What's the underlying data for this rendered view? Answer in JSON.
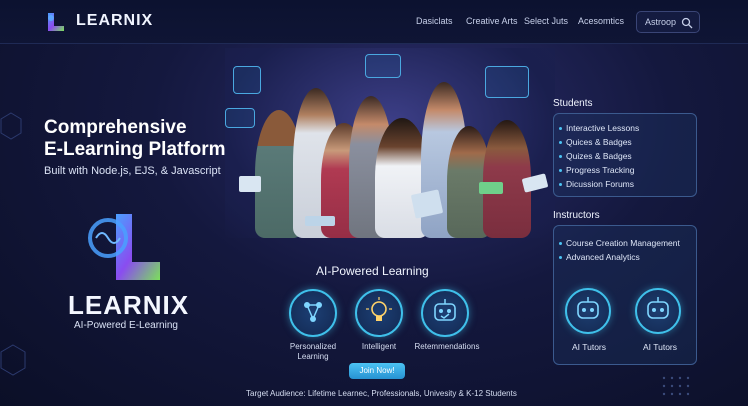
{
  "brand": {
    "name": "LEARNIX",
    "tagline": "AI-Powered E-Learning"
  },
  "nav": {
    "items": [
      "Dasiclats",
      "Creative Arts",
      "Select Juts",
      "Acesomtics"
    ],
    "search_label": "Astroop"
  },
  "hero": {
    "headline_line1": "Comprehensive",
    "headline_line2": "E-Learning Platform",
    "subline": "Built with Node.js, EJS, & Javascript"
  },
  "ai_section": {
    "title": "AI-Powered Learning",
    "features": [
      {
        "label_line1": "Personalized",
        "label_line2": "Learning",
        "icon": "network-icon"
      },
      {
        "label_line1": "Intelligent",
        "label_line2": "",
        "icon": "lightbulb-icon"
      },
      {
        "label_line1": "Retemmendations",
        "label_line2": "",
        "icon": "robot-icon"
      }
    ],
    "join_label": "Join Now!",
    "audience": "Target Audience: Lifetime Learnec, Professionals, Univesity & K-12 Students"
  },
  "students": {
    "heading": "Students",
    "items": [
      "Interactive Lessons",
      "Quices & Badges",
      "Quizes & Badges",
      "Progress Tracking",
      "Dicussion Forums"
    ]
  },
  "instructors": {
    "heading": "Instructors",
    "items": [
      "Course Creation Management",
      "Advanced Analytics"
    ],
    "tutors": [
      "AI Tutors",
      "AI Tutors"
    ]
  },
  "colors": {
    "accent": "#3fc0ea",
    "logo_purple": "#7b4cf0",
    "logo_green": "#7be05a",
    "background": "#14183e"
  }
}
